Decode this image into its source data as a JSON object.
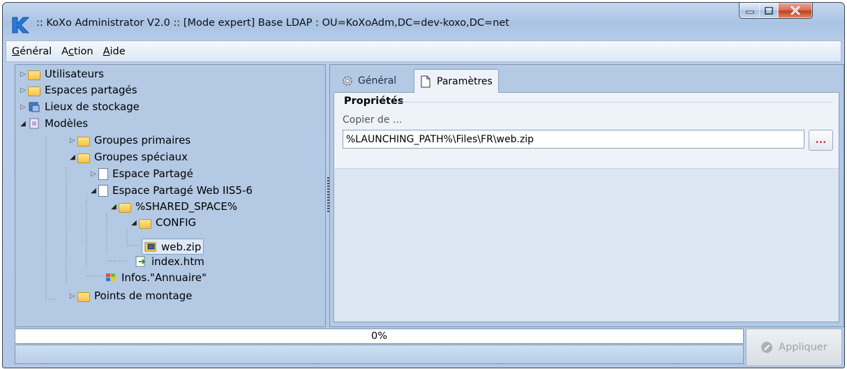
{
  "window": {
    "title": ":: KoXo Administrator V2.0 :: [Mode expert] Base LDAP : OU=KoXoAdm,DC=dev-koxo,DC=net",
    "controls": {
      "minimize_glyph": "▁",
      "maximize_glyph": "▢",
      "close_glyph": "X"
    }
  },
  "menu": [
    {
      "label": "Général"
    },
    {
      "label": "Action"
    },
    {
      "label": "Aide"
    }
  ],
  "tree": [
    {
      "label": "Utilisateurs",
      "level": 0,
      "state": "collapsed",
      "icon": "users-folder-icon"
    },
    {
      "label": "Espaces partagés",
      "level": 0,
      "state": "collapsed",
      "icon": "shared-spaces-icon"
    },
    {
      "label": "Lieux de stockage",
      "level": 0,
      "state": "collapsed",
      "icon": "storage-icon"
    },
    {
      "label": "Modèles",
      "level": 0,
      "state": "expanded",
      "icon": "models-icon"
    },
    {
      "label": "Groupes primaires",
      "level": 1,
      "state": "collapsed",
      "icon": "folder-icon"
    },
    {
      "label": "Groupes spéciaux",
      "level": 1,
      "state": "expanded",
      "icon": "folder-icon"
    },
    {
      "label": "Espace Partagé",
      "level": 2,
      "state": "collapsed",
      "icon": "document-icon"
    },
    {
      "label": "Espace Partagé Web IIS5-6",
      "level": 2,
      "state": "expanded",
      "icon": "document-icon"
    },
    {
      "label": "%SHARED_SPACE%",
      "level": 3,
      "state": "expanded",
      "icon": "folder-icon"
    },
    {
      "label": "CONFIG",
      "level": 4,
      "state": "expanded",
      "icon": "folder-icon"
    },
    {
      "label": "web.zip",
      "level": 5,
      "state": "leaf",
      "icon": "zip-file-icon",
      "selected": true
    },
    {
      "label": "index.htm",
      "level": 4,
      "state": "leaf",
      "icon": "html-file-icon"
    },
    {
      "label": "Infos.\"Annuaire\"",
      "level": 3,
      "state": "leaf",
      "icon": "windows-logo-icon"
    },
    {
      "label": "Points de montage",
      "level": 1,
      "state": "collapsed",
      "icon": "folder-icon"
    }
  ],
  "tabs": [
    {
      "label": "Général",
      "active": false
    },
    {
      "label": "Paramètres",
      "active": true
    }
  ],
  "properties": {
    "section_title": "Propriétés",
    "field_label": "Copier de ...",
    "field_value": "%LAUNCHING_PATH%\\Files\\FR\\web.zip",
    "browse_label": "..."
  },
  "progress": {
    "value_text": "0%",
    "value": 0
  },
  "apply_button": {
    "label": "Appliquer",
    "enabled": false
  },
  "colors": {
    "accent": "#b3c9e4",
    "close": "#c2401f"
  }
}
